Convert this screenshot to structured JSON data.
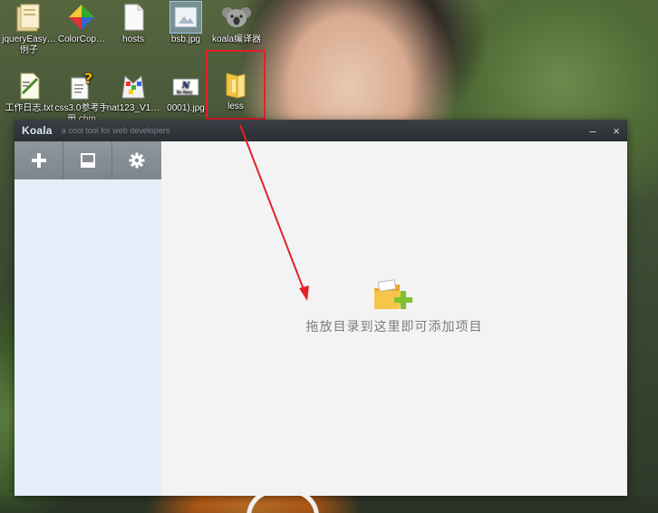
{
  "desktop": {
    "icons": [
      {
        "label": "jqueryEasy…\n例子",
        "icon": "folder-icon"
      },
      {
        "label": "ColorCop…",
        "icon": "colorcop-icon"
      },
      {
        "label": "hosts",
        "icon": "file-icon"
      },
      {
        "label": "bsb.jpg",
        "icon": "image-icon"
      },
      {
        "label": "koala编译器",
        "icon": "koala-icon"
      },
      {
        "label": "工作日志.txt",
        "icon": "text-file-icon"
      },
      {
        "label": "css3.0参考手册.chm",
        "icon": "help-file-icon"
      },
      {
        "label": "nat123_V1…",
        "icon": "installer-icon"
      },
      {
        "label": "0001).jpg",
        "icon": "image-icon"
      },
      {
        "label": "less",
        "icon": "folder-icon"
      }
    ]
  },
  "window": {
    "app_name": "Koala",
    "tagline": "a cool tool for web developers",
    "minimize": "–",
    "close": "×"
  },
  "toolbar": {
    "buttons": [
      {
        "name": "add",
        "icon": "plus-icon"
      },
      {
        "name": "compile",
        "icon": "note-icon"
      },
      {
        "name": "settings",
        "icon": "gear-icon"
      }
    ]
  },
  "main": {
    "drop_hint": "拖放目录到这里即可添加项目",
    "drop_icon": "folder-add-icon"
  },
  "colors": {
    "titlebar": "#2b2e33",
    "sidebar": "#e5eef8",
    "toolbar": "#868d94",
    "highlight": "#e3212a",
    "folder": "#f5c542",
    "plus_green": "#7cc22e"
  }
}
